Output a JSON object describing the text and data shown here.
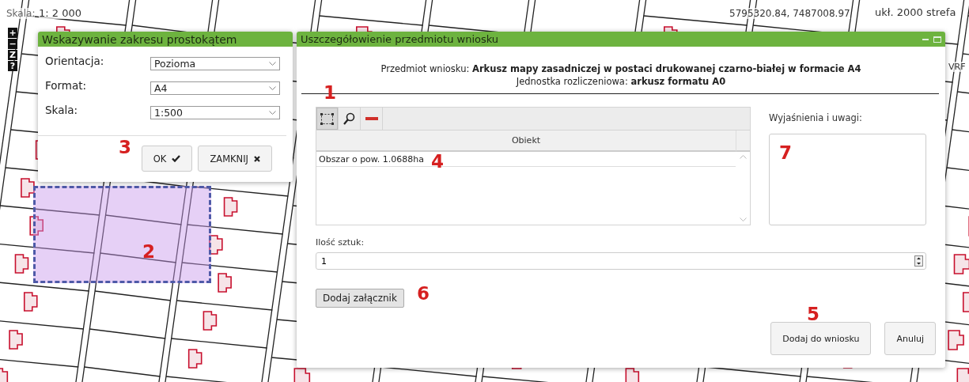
{
  "map": {
    "scale_label": "Skala:",
    "scale_value": "1: 2 000",
    "coordinates": "5795320.84, 7487008.97",
    "crs": "ukł. 2000 strefa",
    "height_system": "VRF",
    "zoom_controls": [
      "+",
      "−",
      "Z",
      "?"
    ]
  },
  "range_dialog": {
    "title": "Wskazywanie zakresu prostokątem",
    "fields": [
      {
        "label": "Orientacja:",
        "value": "Pozioma"
      },
      {
        "label": "Format:",
        "value": "A4"
      },
      {
        "label": "Skala:",
        "value": "1:500"
      }
    ],
    "buttons": [
      {
        "label": "OK"
      },
      {
        "label": "ZAMKNIJ"
      }
    ]
  },
  "detail_dialog": {
    "title": "Uszczegółowienie przedmiotu wniosku",
    "subject": "Przedmiot wniosku: **Arkusz mapy zasadniczej w postaci drukowanej czarno-białej w formacie A4**",
    "unit": "Jednostka rozliczeniowa: **arkusz formatu A0**",
    "tools": [
      {
        "kind": "rectangle",
        "selected": true
      },
      {
        "kind": "search",
        "selected": false
      },
      {
        "kind": "remove",
        "selected": false
      }
    ],
    "table": {
      "columns": [
        "Obiekt"
      ],
      "rows": [
        "Obszar o pow. 1.0688ha"
      ]
    },
    "notes_label": "Wyjaśnienia i uwagi:",
    "quantity_label": "Ilość sztuk:",
    "quantity": "1",
    "attach_button": "Dodaj załącznik",
    "buttons": [
      "Dodaj do wniosku",
      "Anuluj"
    ]
  },
  "annotations": [
    "1",
    "2",
    "3",
    "4",
    "5",
    "6",
    "7"
  ]
}
